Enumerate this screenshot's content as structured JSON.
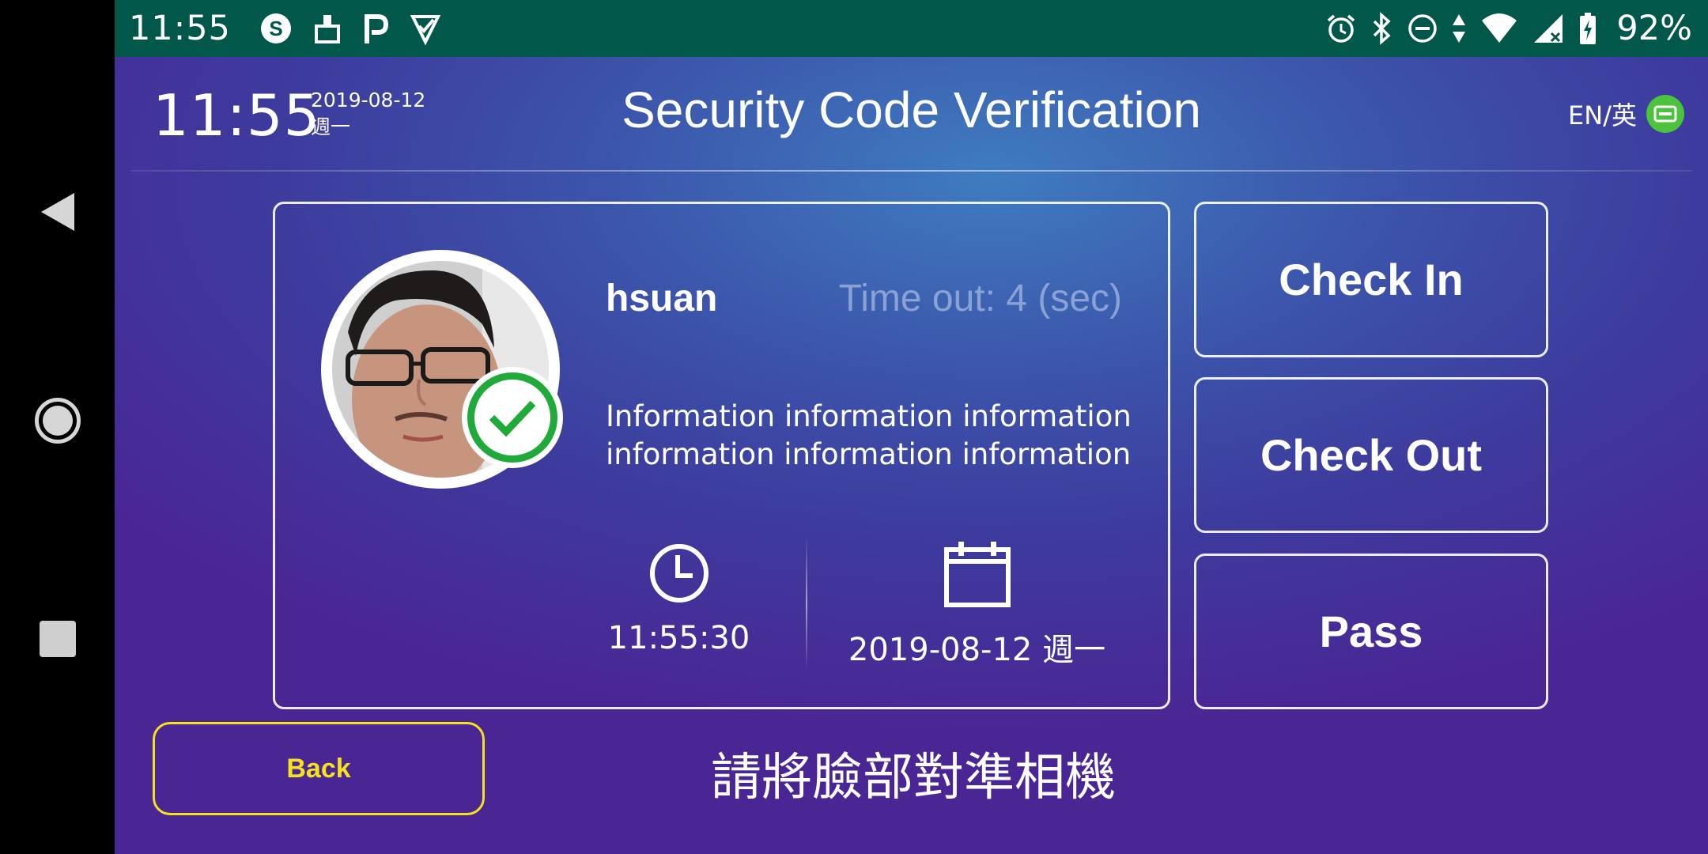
{
  "status_bar": {
    "time": "11:55",
    "battery_percent": "92%",
    "left_icons": [
      "s-app-icon",
      "cleaner-icon",
      "p-app-icon",
      "check-task-icon"
    ],
    "right_icons": [
      "alarm-icon",
      "bluetooth-icon",
      "do-not-disturb-icon",
      "data-arrows-icon",
      "wifi-icon",
      "cell-signal-icon",
      "battery-charging-icon"
    ]
  },
  "nav_bar": {
    "icons": [
      "back-triangle-icon",
      "home-circle-icon",
      "recents-square-icon"
    ]
  },
  "header": {
    "clock": "11:55",
    "date": "2019-08-12",
    "weekday": "週一",
    "title": "Security Code Verification",
    "language_label": "EN/英",
    "language_icon": "keyboard-toggle-icon",
    "language_icon_color": "#4cc23d"
  },
  "card": {
    "user_name": "hsuan",
    "timeout_text": "Time out: 4 (sec)",
    "info_text": "Information information information information information information",
    "time_value": "11:55:30",
    "date_value": "2019-08-12 週一",
    "time_icon": "clock-icon",
    "date_icon": "calendar-icon",
    "verified_color": "#1faa3a"
  },
  "actions": {
    "check_in": "Check In",
    "check_out": "Check Out",
    "pass": "Pass"
  },
  "footer": {
    "back_label": "Back",
    "back_color": "#f5e11c",
    "prompt": "請將臉部對準相機"
  }
}
